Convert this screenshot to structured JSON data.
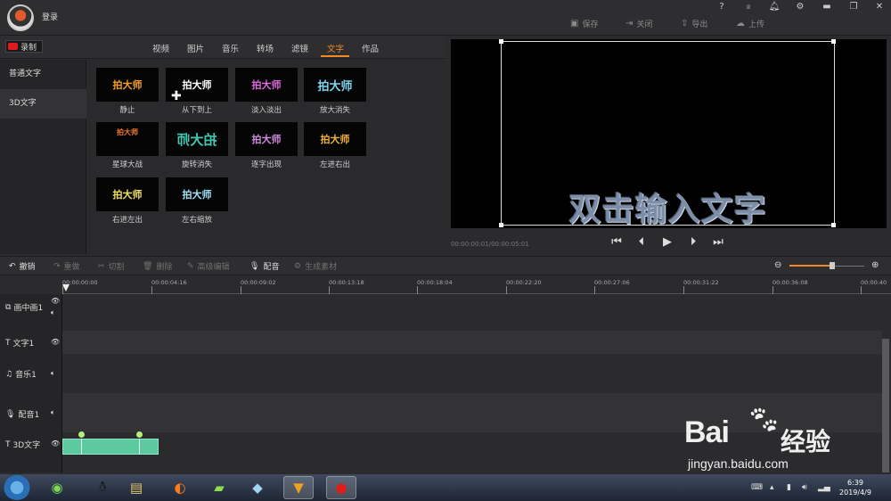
{
  "title_bar": {
    "login": "登录",
    "top_icons": [
      "?",
      "VIP",
      "notification",
      "settings",
      "minimize",
      "restore",
      "close"
    ],
    "buttons": [
      {
        "icon": "save-icon",
        "label": "保存"
      },
      {
        "icon": "close-doc-icon",
        "label": "关闭"
      },
      {
        "icon": "export-icon",
        "label": "导出"
      },
      {
        "icon": "upload-icon",
        "label": "上传"
      }
    ]
  },
  "record_button": "录制",
  "tabs": [
    "视频",
    "图片",
    "音乐",
    "转场",
    "滤镜",
    "文字",
    "作品"
  ],
  "active_tab": "文字",
  "side_categories": [
    "普通文字",
    "3D文字"
  ],
  "selected_category": "3D文字",
  "effects": [
    {
      "thumb": "拍大师",
      "label": "静止",
      "color": "#f5a020"
    },
    {
      "thumb": "拍大师",
      "label": "从下到上",
      "color": "#ffffff"
    },
    {
      "thumb": "拍大师",
      "label": "淡入淡出",
      "color": "#e06adf"
    },
    {
      "thumb": "拍大师",
      "label": "放大消失",
      "color": "#7fd4f0"
    },
    {
      "thumb": "拍大师",
      "label": "星球大战",
      "color": "#f07a2a"
    },
    {
      "thumb": "拍大师",
      "label": "旋转消失",
      "color": "#40c9b0"
    },
    {
      "thumb": "拍大师",
      "label": "逐字出现",
      "color": "#d08ae0"
    },
    {
      "thumb": "拍大师",
      "label": "左进右出",
      "color": "#f0b040"
    },
    {
      "thumb": "拍大师",
      "label": "右进左出",
      "color": "#f0e060"
    },
    {
      "thumb": "拍大师",
      "label": "左右缩放",
      "color": "#9fe0f8"
    }
  ],
  "preview": {
    "caption": "双击输入文字",
    "timecode": "00:00:00:01/00:00:05:01"
  },
  "edit_toolbar": [
    {
      "icon": "undo-icon",
      "label": "撤销",
      "enabled": true
    },
    {
      "icon": "redo-icon",
      "label": "重做",
      "enabled": false
    },
    {
      "icon": "cut-icon",
      "label": "切割",
      "enabled": false
    },
    {
      "icon": "delete-icon",
      "label": "删除",
      "enabled": false
    },
    {
      "icon": "edit-icon",
      "label": "高级编辑",
      "enabled": false
    },
    {
      "icon": "mic-icon",
      "label": "配音",
      "enabled": true
    },
    {
      "icon": "generate-icon",
      "label": "生成素材",
      "enabled": false
    }
  ],
  "zoom": {
    "level": 0.57
  },
  "ruler_ticks": [
    "00:00:00:00",
    "00:00:04:16",
    "00:00:09:02",
    "00:00:13:18",
    "00:00:18:04",
    "00:00:22:20",
    "00:00:27:06",
    "00:00:31:22",
    "00:00:36:08",
    "00:00:40"
  ],
  "tracks": [
    {
      "label": "画中画1",
      "icon": "pip-icon"
    },
    {
      "label": "文字1",
      "icon": "text-icon"
    },
    {
      "label": "音乐1",
      "icon": "music-icon"
    },
    {
      "label": "配音1",
      "icon": "mic-icon"
    },
    {
      "label": "3D文字",
      "icon": "text-icon"
    }
  ],
  "taskbar": {
    "time": "6:39",
    "date": "2019/4/9"
  },
  "watermark": {
    "brand": "Bai",
    "brand2": "经验",
    "url": "jingyan.baidu.com"
  }
}
